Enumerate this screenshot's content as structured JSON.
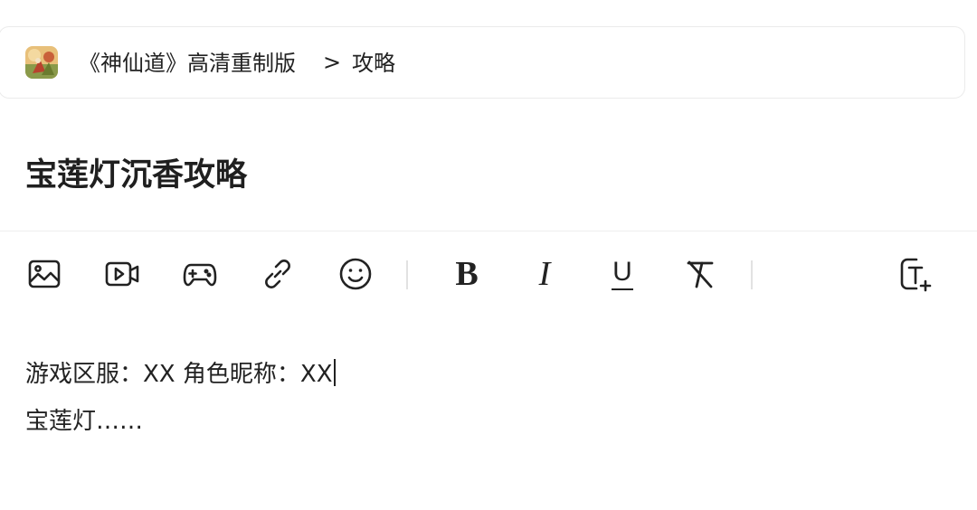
{
  "breadcrumb": {
    "game_name": "《神仙道》高清重制版",
    "separator": ">",
    "current_page": "攻略"
  },
  "post": {
    "title": "宝莲灯沉香攻略"
  },
  "toolbar": {
    "icons": [
      "image-icon",
      "video-icon",
      "gamepad-icon",
      "link-icon",
      "emoji-icon",
      "bold-icon",
      "italic-icon",
      "underline-icon",
      "clear-format-icon",
      "text-size-icon"
    ],
    "bold_label": "B",
    "italic_label": "I",
    "underline_label": "U"
  },
  "editor": {
    "line1": "游戏区服：XX 角色昵称：XX",
    "line2": "宝莲灯……"
  },
  "colors": {
    "text": "#222222",
    "border": "#ebebeb",
    "divider": "#eeeeee"
  }
}
